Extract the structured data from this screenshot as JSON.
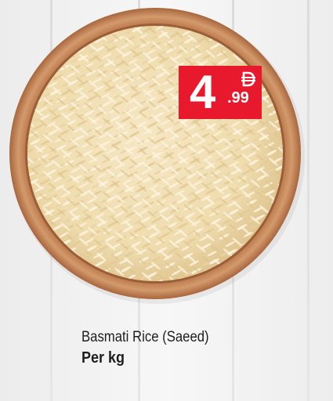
{
  "product": {
    "name": "Basmati Rice (Saeed)",
    "unit": "Per kg"
  },
  "price": {
    "integer": "4",
    "decimal": ".99",
    "currency_icon": "dirham-icon"
  },
  "colors": {
    "price_tag": "#e8192c",
    "bowl": "#c8875a",
    "rice": "#f1dfb5",
    "background": "#f2f2f2"
  }
}
